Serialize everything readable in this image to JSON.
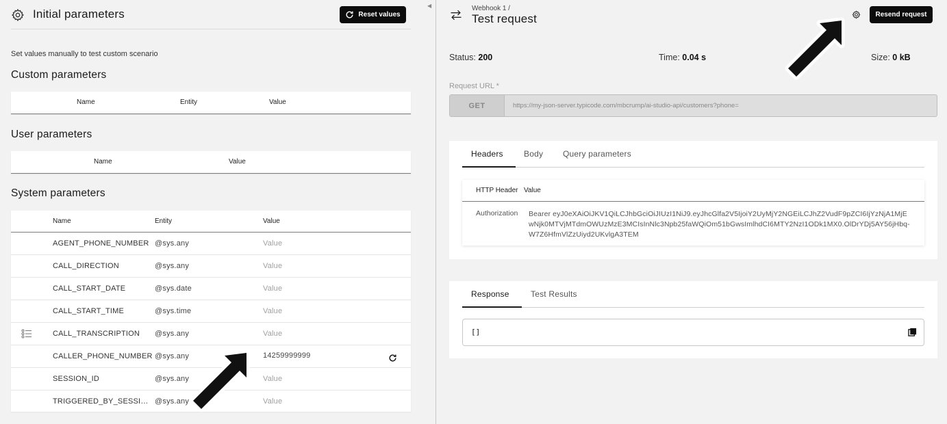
{
  "left": {
    "title": "Initial parameters",
    "reset_label": "Reset values",
    "hint": "Set values manually to test custom scenario",
    "custom": {
      "title": "Custom parameters",
      "headers": [
        "Name",
        "Entity",
        "Value"
      ]
    },
    "user": {
      "title": "User parameters",
      "headers": [
        "Name",
        "Value"
      ]
    },
    "system": {
      "title": "System parameters",
      "headers": [
        "Name",
        "Entity",
        "Value"
      ],
      "rows": [
        {
          "name": "AGENT_PHONE_NUMBER",
          "entity": "@sys.any",
          "value": "Value"
        },
        {
          "name": "CALL_DIRECTION",
          "entity": "@sys.any",
          "value": "Value"
        },
        {
          "name": "CALL_START_DATE",
          "entity": "@sys.date",
          "value": "Value"
        },
        {
          "name": "CALL_START_TIME",
          "entity": "@sys.time",
          "value": "Value"
        },
        {
          "name": "CALL_TRANSCRIPTION",
          "entity": "@sys.any",
          "value": "Value"
        },
        {
          "name": "CALLER_PHONE_NUMBER",
          "entity": "@sys.any",
          "value": "14259999999"
        },
        {
          "name": "SESSION_ID",
          "entity": "@sys.any",
          "value": "Value"
        },
        {
          "name": "TRIGGERED_BY_SESSION...",
          "entity": "@sys.any",
          "value": "Value"
        }
      ]
    }
  },
  "right": {
    "breadcrumb": "Webhook 1  /",
    "title": "Test request",
    "resend_label": "Resend request",
    "status_label": "Status:",
    "status_value": "200",
    "time_label": "Time:",
    "time_value": "0.04 s",
    "size_label": "Size:",
    "size_value": "0 kB",
    "url_label": "Request URL *",
    "method": "GET",
    "url": "https://my-json-server.typicode.com/mbcrump/ai-studio-api/customers?phone=",
    "request_tabs": [
      "Headers",
      "Body",
      "Query parameters"
    ],
    "headers_table": {
      "col_header": "HTTP Header",
      "col_value": "Value",
      "key": "Authorization",
      "value": "Bearer eyJ0eXAiOiJKV1QiLCJhbGciOiJIUzI1NiJ9.eyJhcGlfa2V5IjoiY2UyMjY2NGEiLCJhZ2VudF9pZCI6IjYzNjA1MjEwNjk0MTVjMTdmOWUzMzE3MCIsInNlc3Npb25faWQiOm51bGwsImlhdCI6MTY2NzI1ODk1MX0.OlDrYDj5AY56jHbq-W7Z6HfmVlZzUiyd2UKvlgA3TEM"
    },
    "response_tabs": [
      "Response",
      "Test Results"
    ],
    "response_body": "[]"
  },
  "colors": {
    "button_bg": "#0c0c0c",
    "panel_bg": "#f2f2f2",
    "card_bg": "#ffffff"
  }
}
